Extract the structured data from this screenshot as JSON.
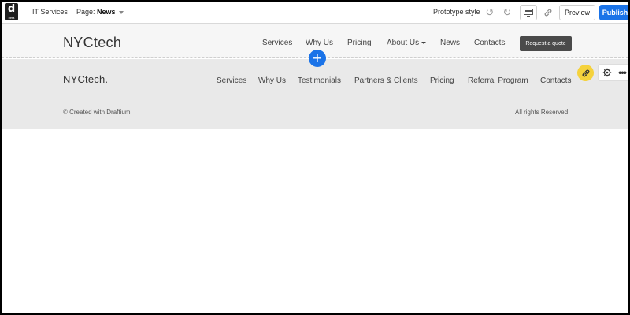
{
  "editor": {
    "logo_letter": "d",
    "logo_badge": "beta",
    "project_name": "IT Services",
    "page_prefix": "Page:",
    "page_name": "News",
    "prototype_style_label": "Prototype style",
    "preview_label": "Preview",
    "publish_label": "Publish",
    "add_section_label": "+",
    "icons": [
      "undo-icon",
      "redo-icon",
      "screen-icon",
      "link-icon",
      "gear-icon",
      "more-icon"
    ],
    "accent_color": "#1a73e8"
  },
  "header": {
    "brand": "NYCtech",
    "nav": [
      "Services",
      "Why Us",
      "Pricing",
      "About Us",
      "News",
      "Contacts"
    ],
    "cta_label": "Request a quote"
  },
  "footer": {
    "brand": "NYCtech.",
    "nav": [
      "Services",
      "Why Us",
      "Testimonials",
      "Partners & Clients",
      "Pricing",
      "Referral Program",
      "Contacts"
    ],
    "copyright": "© Created with Draftium",
    "rights": "All rights Reserved"
  }
}
